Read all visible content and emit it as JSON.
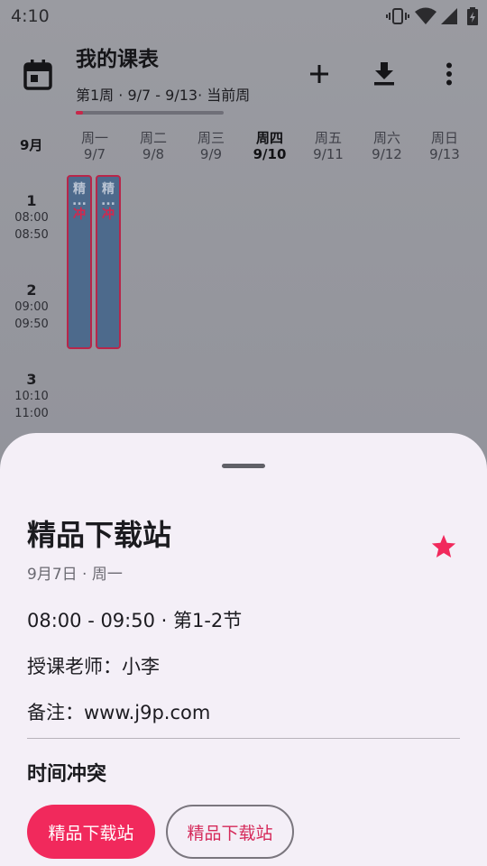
{
  "status_bar": {
    "time": "4:10"
  },
  "header": {
    "title": "我的课表",
    "subtitle": "第1周 · 9/7 - 9/13· 当前周",
    "progress_fraction": 0.05,
    "accent_color": "#c8274a"
  },
  "week": {
    "month": "9月",
    "days": [
      {
        "weekday": "周一",
        "date": "9/7",
        "today": false
      },
      {
        "weekday": "周二",
        "date": "9/8",
        "today": false
      },
      {
        "weekday": "周三",
        "date": "9/9",
        "today": false
      },
      {
        "weekday": "周四",
        "date": "9/10",
        "today": true
      },
      {
        "weekday": "周五",
        "date": "9/11",
        "today": false
      },
      {
        "weekday": "周六",
        "date": "9/12",
        "today": false
      },
      {
        "weekday": "周日",
        "date": "9/13",
        "today": false
      }
    ]
  },
  "periods": [
    {
      "number": "1",
      "start": "08:00",
      "end": "08:50"
    },
    {
      "number": "2",
      "start": "09:00",
      "end": "09:50"
    },
    {
      "number": "3",
      "start": "10:10",
      "end": "11:00"
    }
  ],
  "course_blocks": [
    {
      "name": "精",
      "dots": "...",
      "conflict": "冲",
      "color": "#4d6a8c"
    },
    {
      "name": "精",
      "dots": "...",
      "conflict": "冲",
      "color": "#4d6a8c"
    }
  ],
  "sheet": {
    "title": "精品下载站",
    "date": "9月7日 · 周一",
    "time_line": "08:00 - 09:50 · 第1-2节",
    "teacher_line": "授课老师：小李",
    "note_line": "备注：www.j9p.com",
    "conflict_title": "时间冲突",
    "conflict_chips": [
      {
        "label": "精品下载站",
        "style": "filled"
      },
      {
        "label": "精品下载站",
        "style": "outlined"
      }
    ],
    "star_color": "#f1295c"
  },
  "icons": {
    "calendar": "calendar-icon",
    "add": "plus-icon",
    "download": "download-icon",
    "more": "more-vertical-icon",
    "star": "star-icon"
  }
}
